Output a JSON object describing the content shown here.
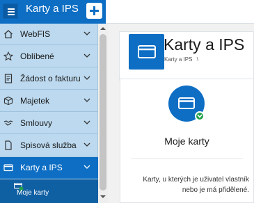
{
  "app": {
    "title": "Karty a IPS",
    "accent": "#0d6ec4",
    "sidebar_bg": "#bcd9ef",
    "active_bg": "#0d6ec4",
    "sub_bg": "#0f5fa3"
  },
  "sidebar": {
    "items": [
      {
        "label": "WebFIS",
        "icon": "home-icon",
        "active": false
      },
      {
        "label": "Oblíbené",
        "icon": "star-icon",
        "active": false
      },
      {
        "label": "Žádost o fakturu",
        "icon": "document-icon",
        "active": false
      },
      {
        "label": "Majetek",
        "icon": "box-icon",
        "active": false
      },
      {
        "label": "Smlouvy",
        "icon": "handshake-icon",
        "active": false
      },
      {
        "label": "Spisová služba",
        "icon": "file-icon",
        "active": false
      },
      {
        "label": "Karty a IPS",
        "icon": "card-icon",
        "active": true
      }
    ],
    "sub_item": {
      "label": "Moje karty",
      "icon": "card-check-icon"
    }
  },
  "main": {
    "header_title": "Karty a IPS",
    "breadcrumb": "Karty a IPS",
    "breadcrumb_sep": "\\",
    "tile": {
      "title": "Moje karty",
      "description": "Karty, u kterých je uživatel vlastník nebo je má přidělené.",
      "icon": "card-icon",
      "badge_icon": "chevron-down-icon"
    }
  }
}
